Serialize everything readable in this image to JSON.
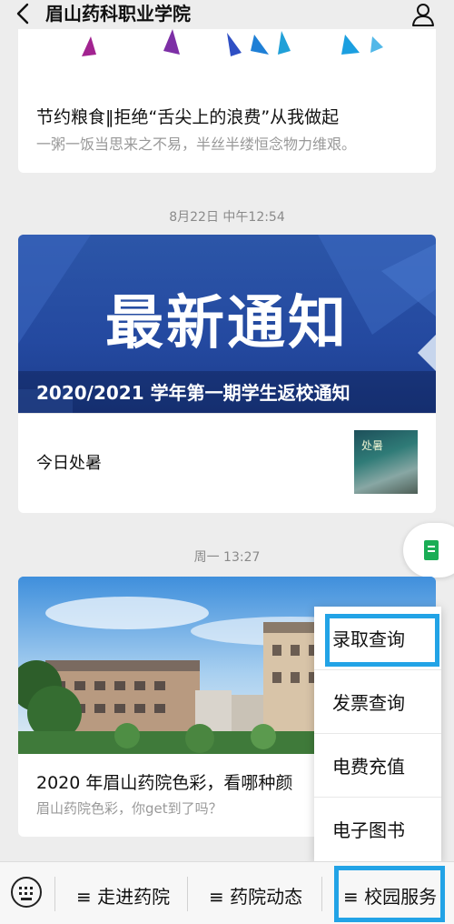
{
  "header": {
    "title": "眉山药科职业学院",
    "back_icon": "chevron-left-icon",
    "profile_icon": "person-icon"
  },
  "articles": [
    {
      "title": "节约粮食‖拒绝“舌尖上的浪费”从我做起",
      "subtitle": "一粥一饭当思来之不易，半丝半缕恒念物力维艰。"
    },
    {
      "time": "8月22日 中午12:54",
      "banner_title": "最新通知",
      "banner_caption": "2020/2021 学年第一期学生返校通知",
      "secondary_title": "今日处暑",
      "thumb_text": "处暑"
    },
    {
      "time": "周一 13:27",
      "title": "2020 年眉山药院色彩，看哪种颜",
      "subtitle": "眉山药院色彩，你get到了吗？"
    }
  ],
  "popup_menu": {
    "items": [
      "录取查询",
      "发票查询",
      "电费充值",
      "电子图书"
    ],
    "highlighted": "录取查询"
  },
  "bottom_bar": {
    "keyboard_icon": "keyboard-icon",
    "tabs": [
      "≡ 走进药院",
      "≡ 药院动态",
      "≡ 校园服务"
    ],
    "active_tab": "≡ 校园服务"
  },
  "colors": {
    "highlight": "#22a3e6",
    "notice_banner": "#2449a0",
    "float_icon": "#1aad55"
  }
}
